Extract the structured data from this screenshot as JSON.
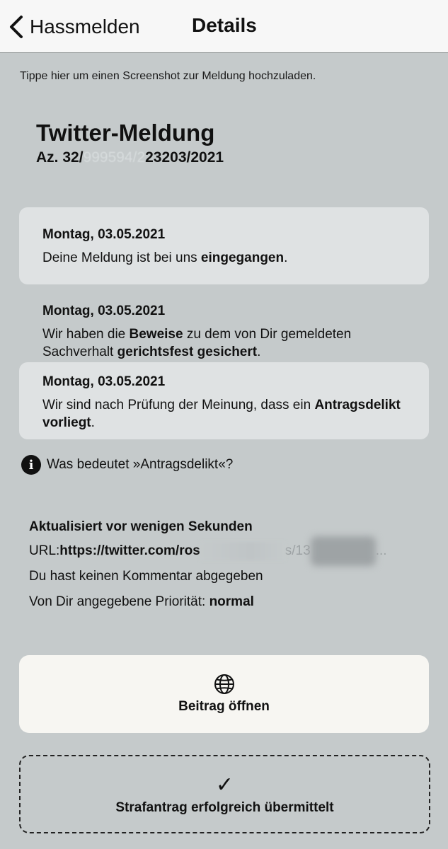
{
  "nav": {
    "back_label": "Hassmelden",
    "title": "Details"
  },
  "upload_hint": "Tippe hier um einen Screenshot zur Meldung hochzuladen.",
  "report": {
    "title": "Twitter-Meldung",
    "ref_prefix": "Az. 32/",
    "ref_hidden": "999594/2",
    "ref_suffix": "23203/2021"
  },
  "timeline": [
    {
      "date": "Montag, 03.05.2021",
      "text_a": "Deine Meldung ist bei uns ",
      "bold_a": "eingegangen",
      "text_b": ".",
      "bold_b": "",
      "text_c": ""
    },
    {
      "date": "Montag, 03.05.2021",
      "text_a": "Wir haben die ",
      "bold_a": "Beweise",
      "text_b": " zu dem von Dir gemeldeten Sachverhalt ",
      "bold_b": "gerichtsfest gesichert",
      "text_c": "."
    },
    {
      "date": "Montag, 03.05.2021",
      "text_a": "Wir sind nach Prüfung der Meinung, dass ein ",
      "bold_a": "Antragsdelikt vorliegt",
      "text_b": ".",
      "bold_b": "",
      "text_c": ""
    }
  ],
  "info_link": "Was bedeutet »Antragsdelikt«?",
  "meta": {
    "updated": "Aktualisiert vor wenigen Sekunden",
    "url_label": "URL: ",
    "url_visible": "https://twitter.com/ros",
    "url_mid": "s/13",
    "url_end": "...",
    "comment": "Du hast keinen Kommentar abgegeben",
    "priority_label": "Von Dir angegebene Priorität: ",
    "priority_value": "normal"
  },
  "open_button": {
    "label": "Beitrag öffnen",
    "icon": "globe-icon"
  },
  "status_box": {
    "label": "Strafantrag erfolgreich übermittelt",
    "icon": "checkmark-icon"
  }
}
